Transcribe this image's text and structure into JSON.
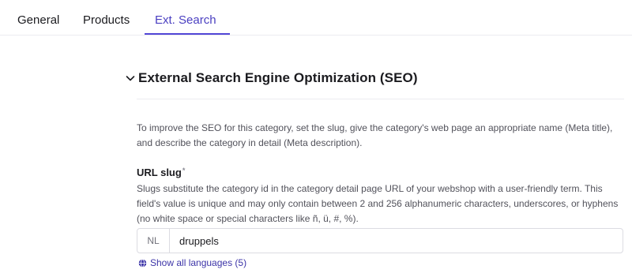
{
  "tabs": [
    {
      "label": "General"
    },
    {
      "label": "Products"
    },
    {
      "label": "Ext. Search"
    }
  ],
  "active_tab": "Ext. Search",
  "section": {
    "title": "External Search Engine Optimization (SEO)",
    "expanded": true,
    "intro": "To improve the SEO for this category, set the slug, give the category's web page an appropriate name (Meta title), and describe the category in detail (Meta description)."
  },
  "url_slug": {
    "label": "URL slug",
    "required_marker": "*",
    "help": "Slugs substitute the category id in the category detail page URL of your webshop with a user-friendly term. This field's value is unique and may only contain between 2 and 256 alphanumeric characters, underscores, or hyphens (no white space or special characters like ñ, ü, #, %).",
    "language_prefix": "NL",
    "value": "druppels",
    "show_languages_label": "Show all languages (5)"
  },
  "colors": {
    "accent": "#5247d6",
    "link": "#3d35a8",
    "text": "#1b1b1f",
    "muted": "#52525b",
    "border": "#dcdce2"
  },
  "icons": {
    "section_toggle": "chevron-down-icon",
    "show_languages": "globe-icon"
  }
}
